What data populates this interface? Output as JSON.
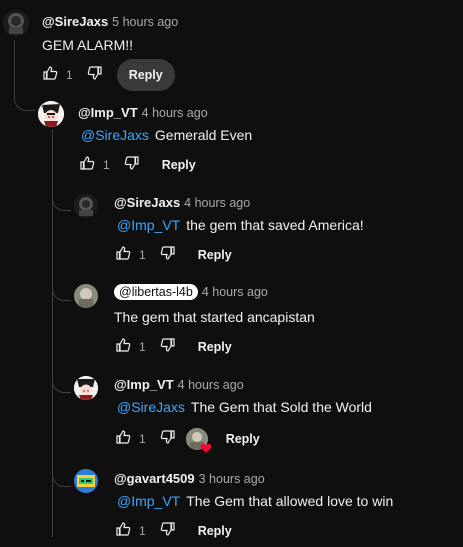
{
  "comments": [
    {
      "author": "@SireJaxs",
      "time": "5 hours ago",
      "mention": "",
      "text": "GEM ALARM!!",
      "likes": "1",
      "reply": "Reply"
    },
    {
      "author": "@Imp_VT",
      "time": "4 hours ago",
      "mention": "@SireJaxs",
      "text": "Gemerald Even",
      "likes": "1",
      "reply": "Reply"
    },
    {
      "author": "@SireJaxs",
      "time": "4 hours ago",
      "mention": "@Imp_VT",
      "text": "the gem that saved America!",
      "likes": "1",
      "reply": "Reply"
    },
    {
      "author": "@libertas-l4b",
      "time": "4 hours ago",
      "mention": "",
      "text": "The gem that started ancapistan",
      "likes": "1",
      "reply": "Reply"
    },
    {
      "author": "@Imp_VT",
      "time": "4 hours ago",
      "mention": "@SireJaxs",
      "text": "The Gem that Sold the World",
      "likes": "1",
      "reply": "Reply"
    },
    {
      "author": "@gavart4509",
      "time": "3 hours ago",
      "mention": "@Imp_VT",
      "text": "The Gem that allowed love to win",
      "likes": "1",
      "reply": "Reply"
    }
  ],
  "icons": {
    "like": "thumbs-up-icon",
    "dislike": "thumbs-down-icon",
    "heart": "creator-heart-icon"
  },
  "colors": {
    "background": "#0f0f0f",
    "mention": "#3ea6ff",
    "muted": "#aaaaaa",
    "heart": "#ff0033"
  }
}
